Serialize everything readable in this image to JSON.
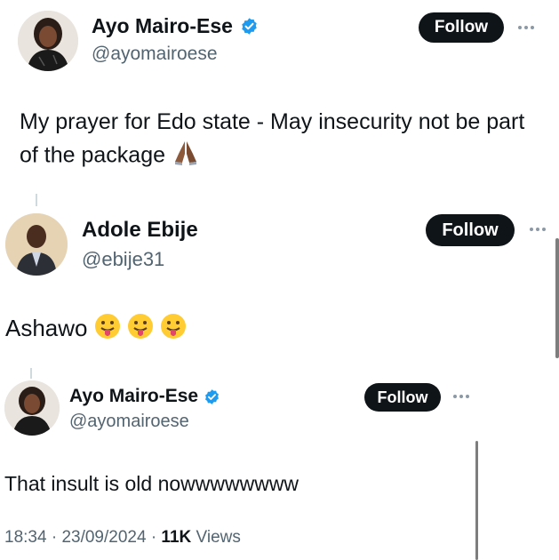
{
  "posts": [
    {
      "author": "Ayo Mairo-Ese",
      "handle": "@ayomairoese",
      "verified": true,
      "follow_label": "Follow",
      "text": "My prayer for Edo state - May insecurity not be part of the package",
      "emoji": "folded-hands"
    },
    {
      "author": "Adole Ebije",
      "handle": "@ebije31",
      "verified": false,
      "follow_label": "Follow",
      "text": "Ashawo",
      "emoji": "tongue-out x3"
    },
    {
      "author": "Ayo Mairo-Ese",
      "handle": "@ayomairoese",
      "verified": true,
      "follow_label": "Follow",
      "text": "That insult is old nowwwwwwww"
    }
  ],
  "meta": {
    "time": "18:34",
    "date": "23/09/2024",
    "views_count": "11K",
    "views_label": "Views",
    "separator": "·"
  },
  "colors": {
    "text": "#0f1419",
    "secondary": "#536471",
    "follow_bg": "#0f1419",
    "verified": "#1d9bf0",
    "thread_line": "#cfd9de"
  }
}
